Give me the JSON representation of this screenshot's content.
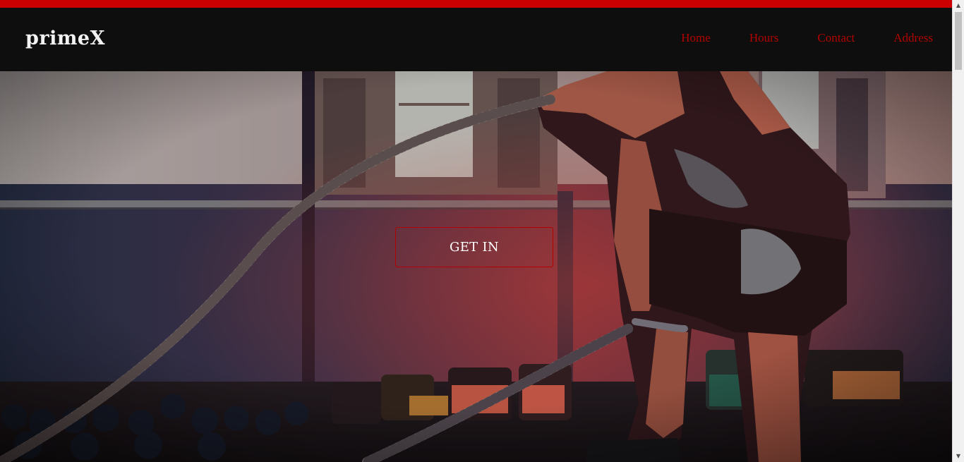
{
  "brand": {
    "name": "primeX"
  },
  "nav": {
    "items": [
      {
        "label": "Home"
      },
      {
        "label": "Hours"
      },
      {
        "label": "Contact"
      },
      {
        "label": "Address"
      }
    ]
  },
  "hero": {
    "cta_label": "GET IN",
    "image_icon": "hero-photo-battle-ropes"
  },
  "colors": {
    "accent": "#cc0000",
    "nav_text": "#b30000",
    "navbar_bg": "#0e0e0e",
    "brand_text": "#f2f2f2"
  },
  "scrollbar": {
    "up_icon": "scroll-up-arrow-icon",
    "down_icon": "scroll-down-arrow-icon"
  }
}
